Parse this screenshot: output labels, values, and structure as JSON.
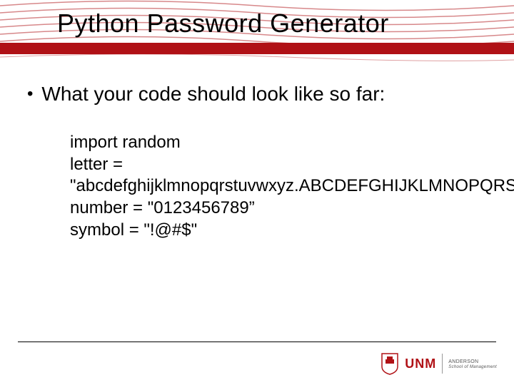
{
  "title": "Python Password Generator",
  "bullet": {
    "text": "What your code should look like so far:"
  },
  "code": {
    "line1": "import random",
    "line2": "letter = \"abcdefghijklmnopqrstuvwxyz.ABCDEFGHIJKLMNOPQRSTUVWXYZ”",
    "line3": "number = \"0123456789”",
    "line4": "symbol = \"!@#$\""
  },
  "footer": {
    "logo_main": "UNM",
    "logo_sub1": "ANDERSON",
    "logo_sub2": "School of Management"
  }
}
